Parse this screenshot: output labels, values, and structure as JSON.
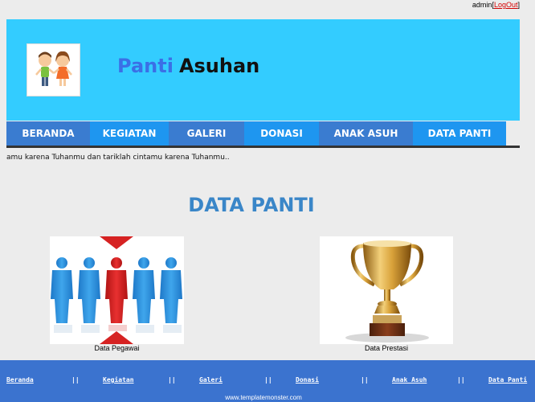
{
  "colors": {
    "header_bg": "#33ccff",
    "nav_dark": "#3a7cd0",
    "nav_light": "#1e96f0",
    "title_blue": "#3a86c8",
    "footer_bg": "#3b73cf",
    "logout_red": "#d40000"
  },
  "topbar": {
    "user": "admin",
    "open_bracket": "[",
    "logout_label": "LogOut",
    "close_bracket": "]"
  },
  "header": {
    "logo_icon": "children-icon",
    "title_part1": "Panti",
    "title_part2": "Asuhan"
  },
  "nav": {
    "items": [
      {
        "label": "BERANDA"
      },
      {
        "label": "KEGIATAN"
      },
      {
        "label": "GALERI"
      },
      {
        "label": "DONASI"
      },
      {
        "label": "ANAK ASUH"
      },
      {
        "label": "DATA PANTI"
      }
    ]
  },
  "marquee": {
    "text": "amu karena Tuhanmu dan tariklah cintamu karena Tuhanmu.."
  },
  "main": {
    "title": "DATA PANTI",
    "cards": [
      {
        "icon": "employees-icon",
        "caption": "Data Pegawai"
      },
      {
        "icon": "trophy-icon",
        "caption": "Data Prestasi"
      }
    ]
  },
  "footer": {
    "links": [
      "Beranda",
      "Kegiatan",
      "Galeri",
      "Donasi",
      "Anak Asuh",
      "Data Panti"
    ],
    "separator": "||",
    "credit": "www.templatemonster.com"
  }
}
